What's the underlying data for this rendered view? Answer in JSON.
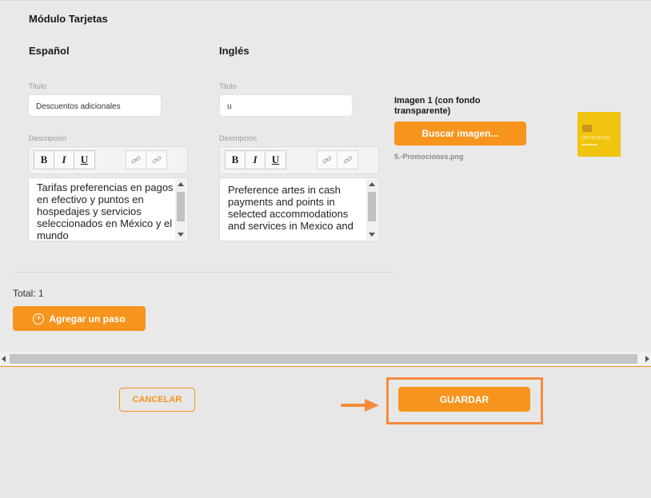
{
  "module": {
    "title": "Módulo Tarjetas"
  },
  "spanish": {
    "heading": "Español",
    "title_label": "Titulo",
    "title_value": "Descuentos adicionales",
    "description_label": "Descripción",
    "description_text": "Tarifas preferencias en pagos en efectivo y puntos en hospedajes y servicios seleccionados en México y el mundo"
  },
  "english": {
    "heading": "Inglés",
    "title_label": "Titulo",
    "title_value": "u",
    "description_label": "Descripción",
    "description_text": "Preference artes in cash payments and points in selected accommodations and services in Mexico and"
  },
  "toolbar": {
    "bold": "B",
    "italic": "I",
    "underline": "U",
    "link_icon": "link-icon",
    "unlink_icon": "unlink-icon"
  },
  "image": {
    "label": "Imagen 1 (con fondo transparente)",
    "search_button": "Buscar imagen...",
    "file_name": "5.-Promociones.png",
    "card_number": "1234 5678 9123"
  },
  "steps": {
    "total_label": "Total: 1",
    "add_button": "Agregar un paso",
    "add_icon": "plus-circle-icon"
  },
  "footer": {
    "cancel_button": "CANCELAR",
    "save_button": "GUARDAR"
  },
  "colors": {
    "accent": "#f7941d",
    "highlight": "#f58b3c",
    "background": "#e7e7e7"
  }
}
